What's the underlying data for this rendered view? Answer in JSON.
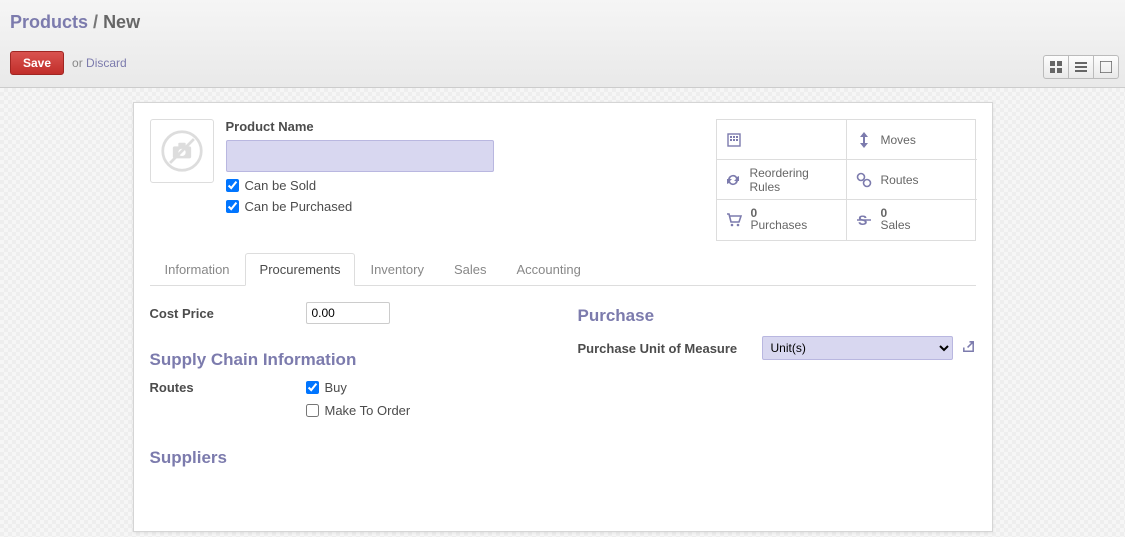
{
  "breadcrumb": {
    "root": "Products",
    "sep": "/",
    "current": "New"
  },
  "toolbar": {
    "save_label": "Save",
    "or_label": "or",
    "discard_label": "Discard"
  },
  "product": {
    "name_label": "Product Name",
    "name_value": "",
    "can_be_sold_label": "Can be Sold",
    "can_be_sold_checked": true,
    "can_be_purchased_label": "Can be Purchased",
    "can_be_purchased_checked": true
  },
  "stats": {
    "moves": "Moves",
    "reordering": "Reordering Rules",
    "routes": "Routes",
    "purchases_count": "0",
    "purchases_label": "Purchases",
    "sales_count": "0",
    "sales_label": "Sales"
  },
  "tabs": {
    "information": "Information",
    "procurements": "Procurements",
    "inventory": "Inventory",
    "sales": "Sales",
    "accounting": "Accounting"
  },
  "procurements": {
    "cost_price_label": "Cost Price",
    "cost_price_value": "0.00",
    "purchase_heading": "Purchase",
    "purchase_uom_label": "Purchase Unit of Measure",
    "purchase_uom_value": "Unit(s)",
    "supply_chain_heading": "Supply Chain Information",
    "routes_label": "Routes",
    "route_buy_label": "Buy",
    "route_buy_checked": true,
    "route_mto_label": "Make To Order",
    "route_mto_checked": false,
    "suppliers_heading": "Suppliers"
  }
}
